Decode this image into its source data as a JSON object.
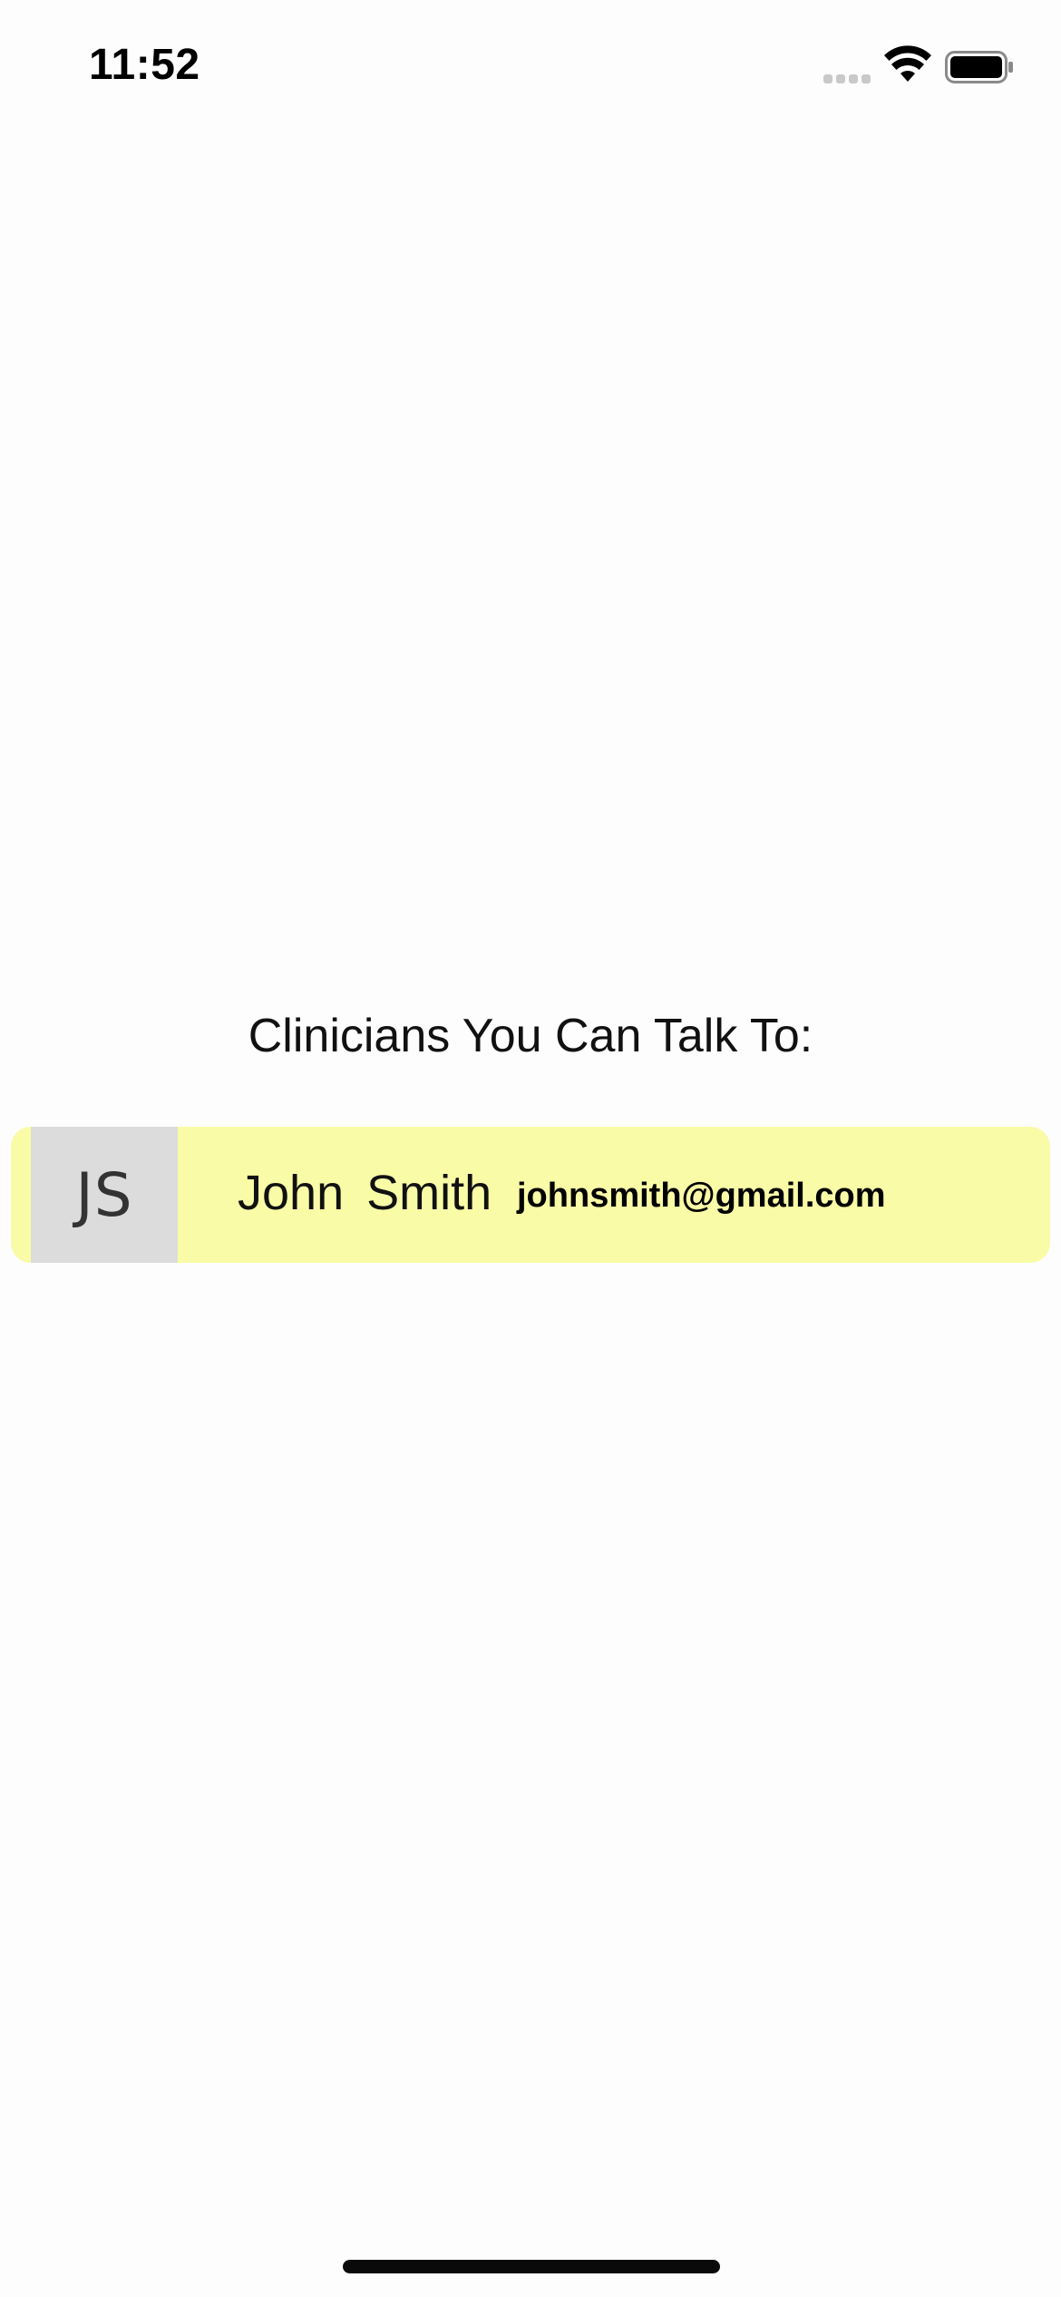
{
  "status_bar": {
    "time": "11:52",
    "icons": [
      "signal-icon",
      "wifi-icon",
      "battery-icon"
    ]
  },
  "main": {
    "heading": "Clinicians You Can Talk To:",
    "clinicians": [
      {
        "initials": "JS",
        "name": "John  Smith",
        "email": "johnsmith@gmail.com"
      }
    ]
  },
  "colors": {
    "card_background": "#f9fba6",
    "avatar_background": "#dcdcdc",
    "page_background": "#fdfdfd"
  }
}
